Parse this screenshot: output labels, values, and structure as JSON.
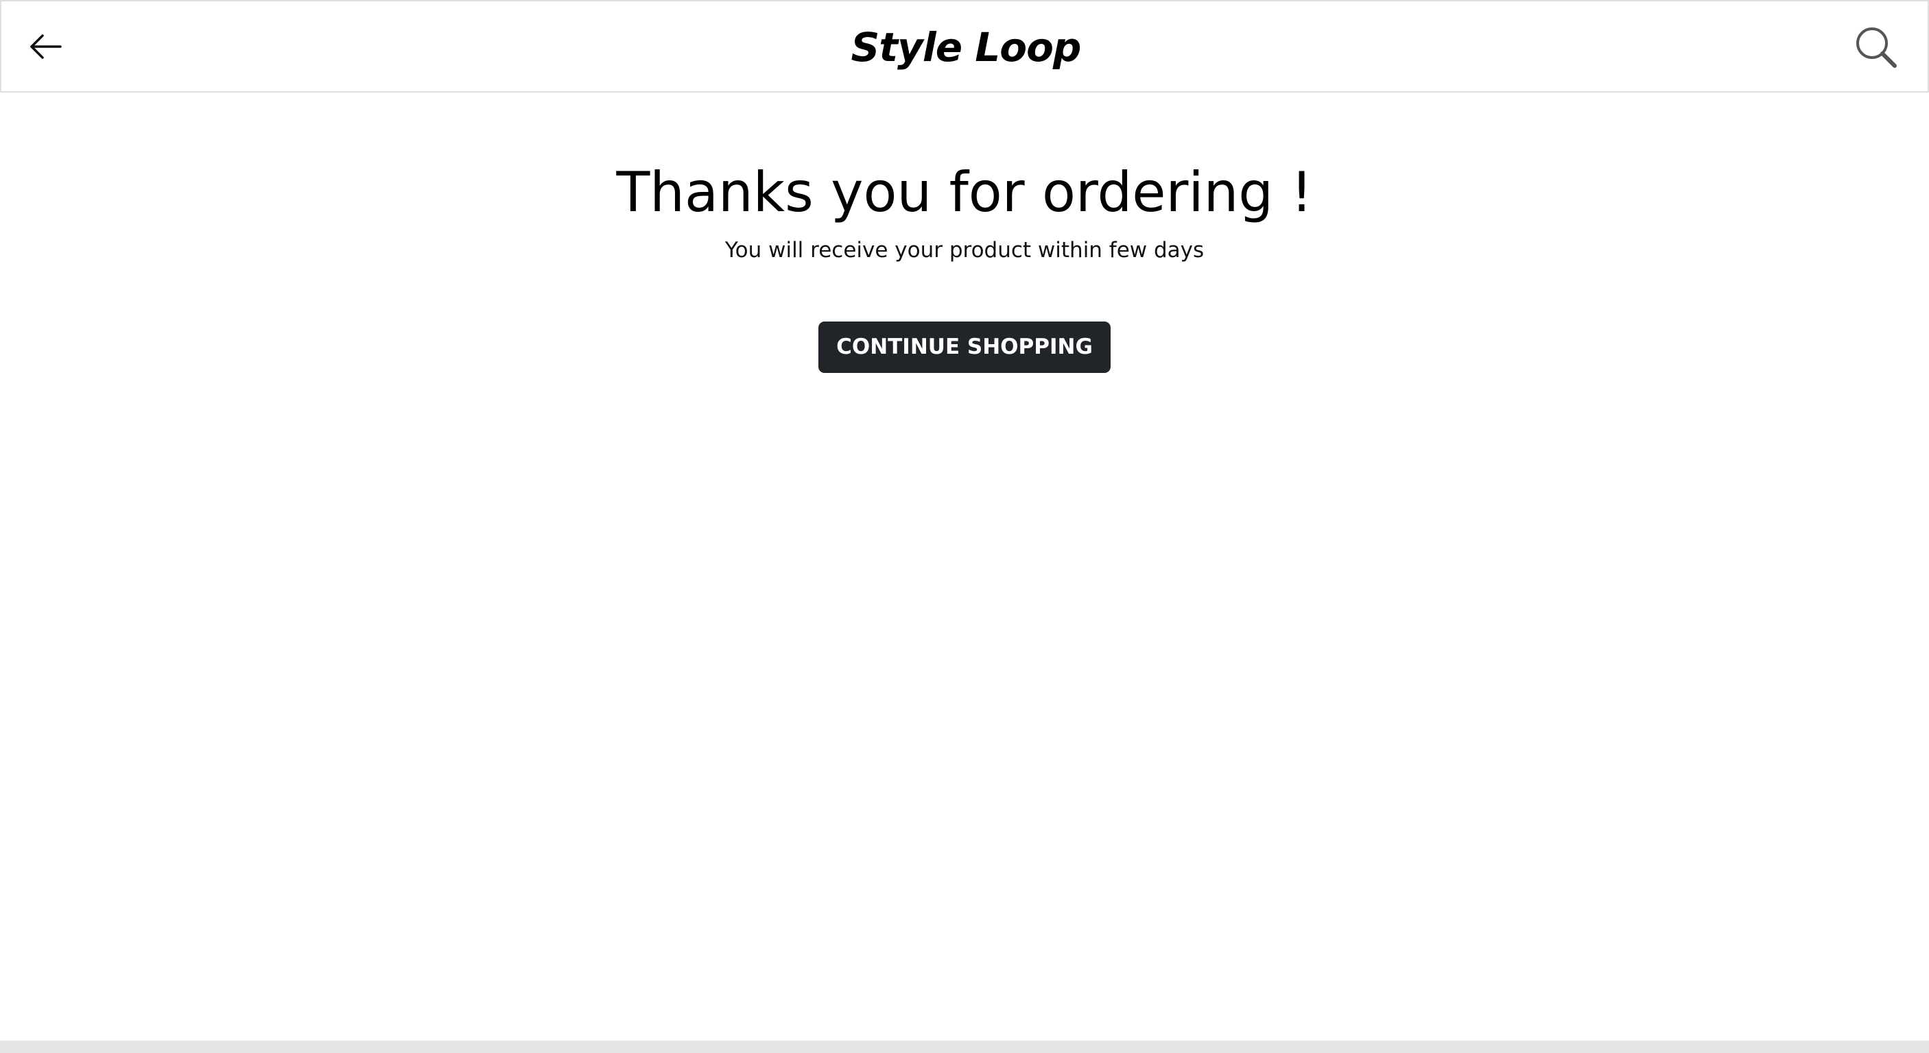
{
  "header": {
    "brand": "Style Loop",
    "back_icon": "arrow-left-icon",
    "search_icon": "search-icon"
  },
  "main": {
    "title": "Thanks you for ordering !",
    "subtitle": "You will receive your product within few days",
    "continue_label": "CONTINUE SHOPPING"
  },
  "colors": {
    "button_bg": "#212529",
    "button_text": "#ffffff",
    "header_border": "#dedede",
    "footer_bar": "#e6e6e6"
  }
}
